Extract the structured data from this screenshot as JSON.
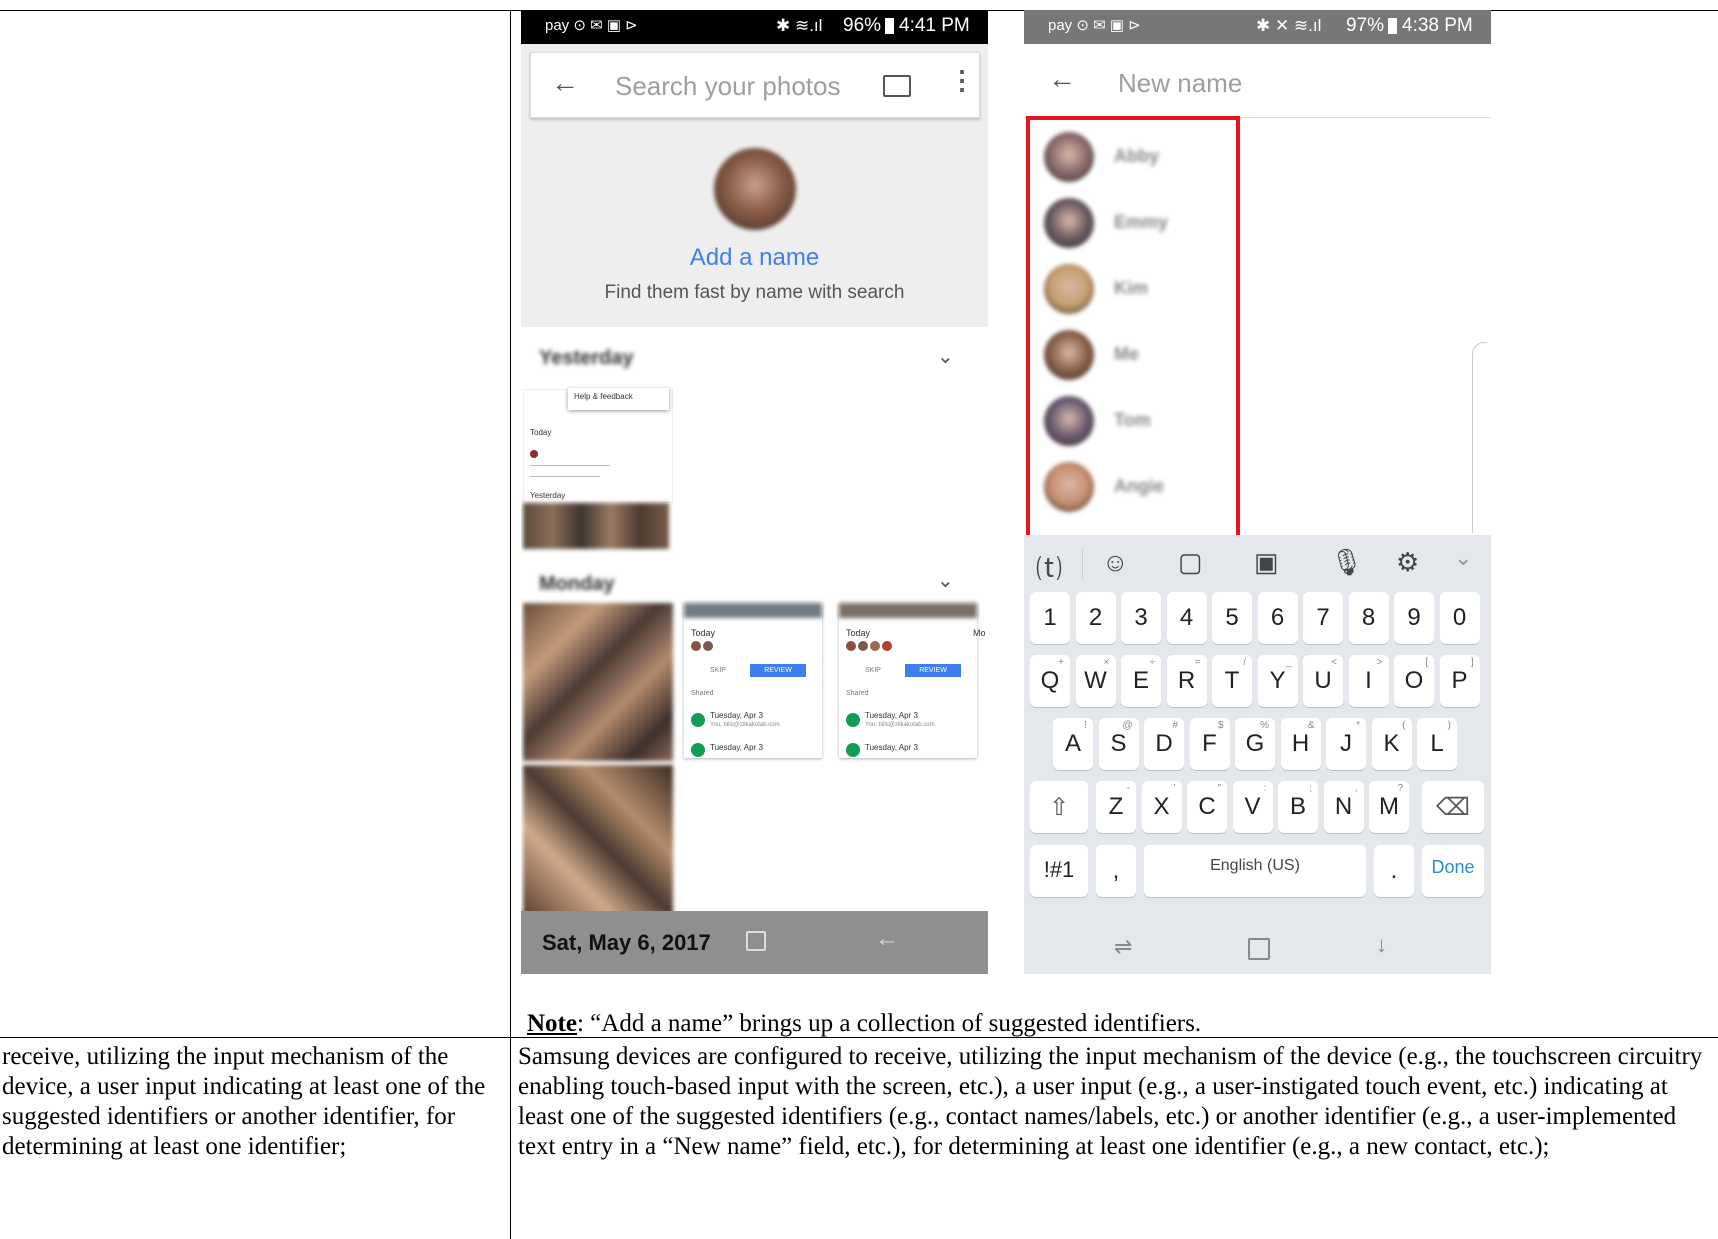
{
  "left_screen": {
    "status_time": "4:41 PM",
    "status_battery": "96%",
    "search_placeholder": "Search your photos",
    "add_name": "Add a name",
    "find_text": "Find them fast by name with search",
    "section1": "Yesterday",
    "section2": "Monday",
    "mini_menu": "Help & feedback",
    "mini_today": "Today",
    "mini_yesterday": "Yesterday",
    "card_today": "Today",
    "card_skip": "SKIP",
    "card_review": "REVIEW",
    "card_shared": "Shared",
    "card_date": "Tuesday, Apr 3",
    "card_email": "You, bills@zilkakotab.com",
    "card3_label": "Mo",
    "bottom_date": "Sat, May 6, 2017",
    "icons": [
      "back-arrow-icon",
      "cast-icon",
      "more-vert-icon",
      "chevron-down-icon"
    ]
  },
  "right_screen": {
    "status_time": "4:38 PM",
    "status_battery": "97%",
    "new_name_placeholder": "New name",
    "suggested_names": [
      "Abby",
      "Emmy",
      "Kim",
      "Me",
      "Tom",
      "Angie"
    ],
    "highlight_color": "#e8141c",
    "keyboard": {
      "number_row": [
        "1",
        "2",
        "3",
        "4",
        "5",
        "6",
        "7",
        "8",
        "9",
        "0"
      ],
      "row1": [
        {
          "k": "Q",
          "s": "+"
        },
        {
          "k": "W",
          "s": "×"
        },
        {
          "k": "E",
          "s": "÷"
        },
        {
          "k": "R",
          "s": "="
        },
        {
          "k": "T",
          "s": "/"
        },
        {
          "k": "Y",
          "s": "_"
        },
        {
          "k": "U",
          "s": "<"
        },
        {
          "k": "I",
          "s": ">"
        },
        {
          "k": "O",
          "s": "["
        },
        {
          "k": "P",
          "s": "]"
        }
      ],
      "row2": [
        {
          "k": "A",
          "s": "!"
        },
        {
          "k": "S",
          "s": "@"
        },
        {
          "k": "D",
          "s": "#"
        },
        {
          "k": "F",
          "s": "$"
        },
        {
          "k": "G",
          "s": "%"
        },
        {
          "k": "H",
          "s": "&"
        },
        {
          "k": "J",
          "s": "*"
        },
        {
          "k": "K",
          "s": "("
        },
        {
          "k": "L",
          "s": ")"
        }
      ],
      "row3": [
        {
          "k": "Z",
          "s": "-"
        },
        {
          "k": "X",
          "s": "'"
        },
        {
          "k": "C",
          "s": "\""
        },
        {
          "k": "V",
          "s": ":"
        },
        {
          "k": "B",
          "s": ";"
        },
        {
          "k": "N",
          "s": ","
        },
        {
          "k": "M",
          "s": "?"
        }
      ],
      "symbols_key": "!#1",
      "comma_key": ",",
      "space_key": "English (US)",
      "period_key": ".",
      "done_key": "Done"
    }
  },
  "note": {
    "label": "Note",
    "text": ": “Add a name” brings up a collection of suggested identifiers."
  },
  "claim_text": "receive, utilizing the input mechanism of the device, a user input indicating at least one of the suggested identifiers or another identifier, for determining at least one identifier;",
  "evidence_text": "Samsung devices are configured to receive, utilizing the input mechanism of the device (e.g., the touchscreen circuitry enabling touch-based input with the screen, etc.), a user input (e.g., a user-instigated touch event, etc.) indicating at least one of the suggested identifiers (e.g., contact names/labels, etc.) or another identifier (e.g., a user-implemented text entry in a “New name” field, etc.), for determining at least one identifier (e.g., a new contact, etc.);"
}
